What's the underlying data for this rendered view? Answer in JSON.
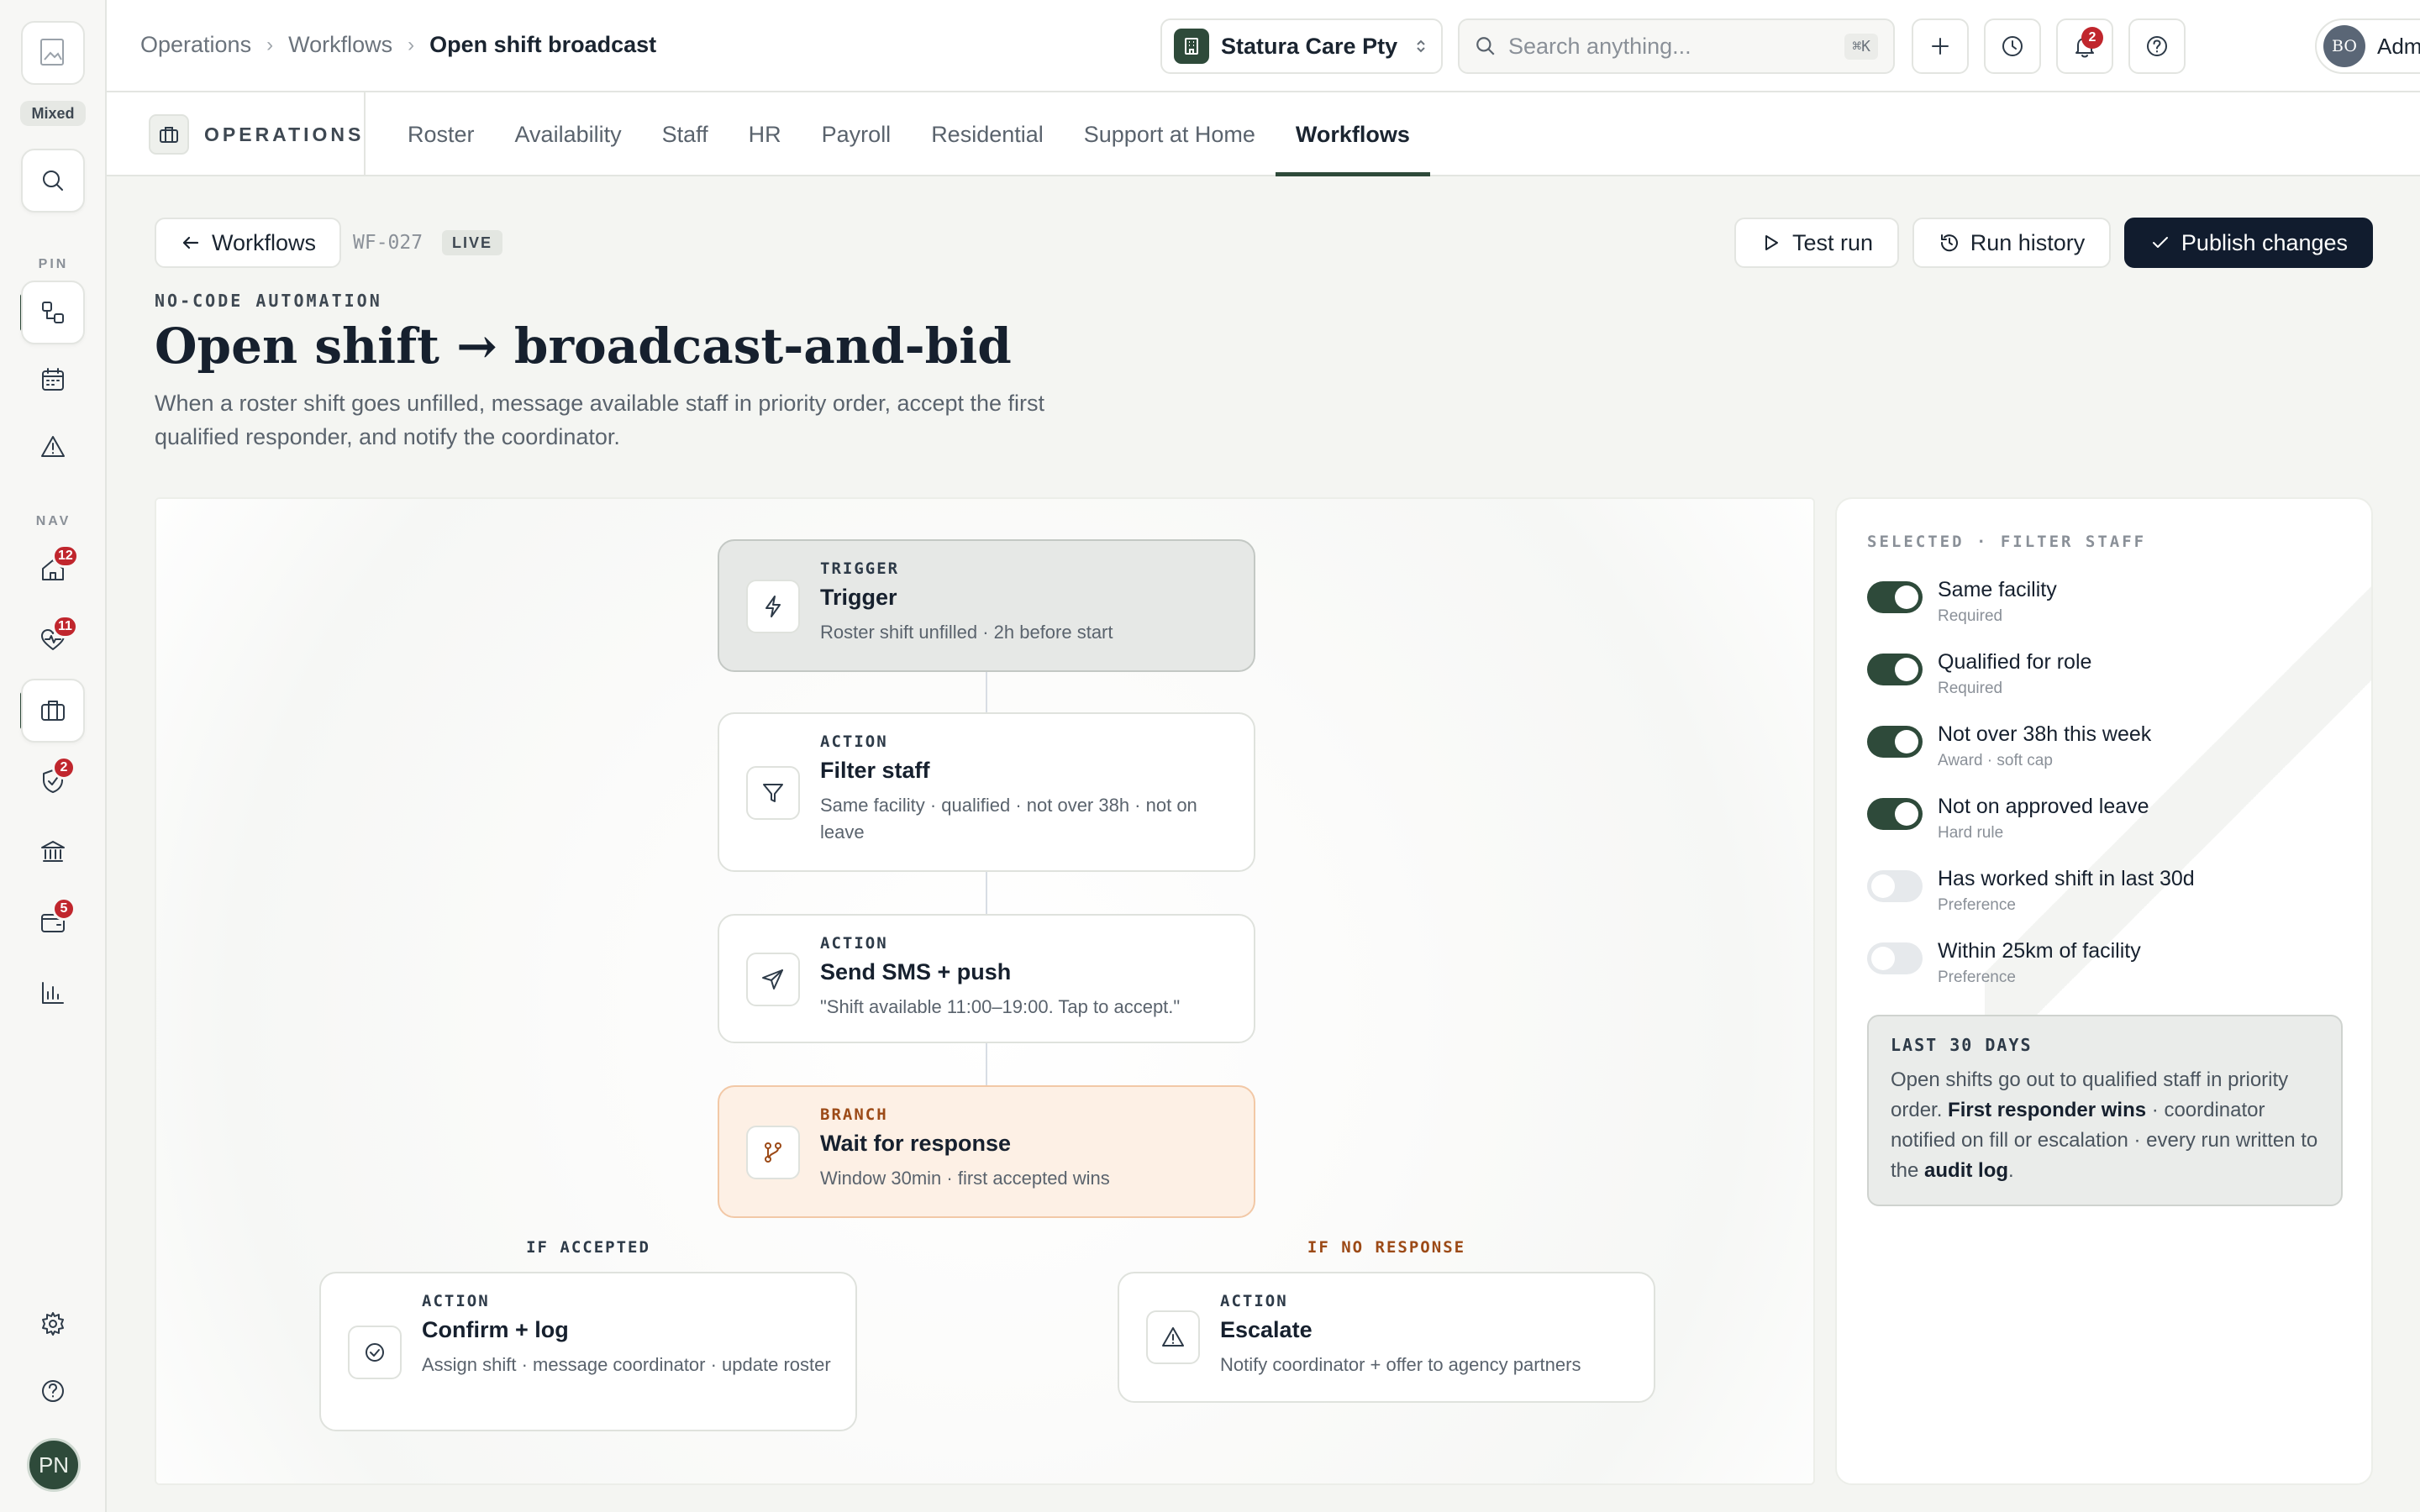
{
  "sidebar": {
    "badge_mode": "Mixed",
    "pin_label": "PIN",
    "nav_label": "NAV",
    "badges": {
      "home": "12",
      "health": "11",
      "shield": "2",
      "wallet": "5"
    },
    "avatar_initials": "PN"
  },
  "header": {
    "breadcrumbs": [
      "Operations",
      "Workflows",
      "Open shift broadcast"
    ],
    "org": "Statura Care Pty",
    "search_placeholder": "Search anything...",
    "search_shortcut": "⌘K",
    "notifications_count": "2",
    "user_initials": "BO",
    "user_name": "Admin"
  },
  "subnav": {
    "section": "OPERATIONS",
    "tabs": [
      "Roster",
      "Availability",
      "Staff",
      "HR",
      "Payroll",
      "Residential",
      "Support at Home",
      "Workflows"
    ],
    "active_tab": "Workflows"
  },
  "page": {
    "back_label": "Workflows",
    "workflow_id": "WF-027",
    "status": "LIVE",
    "eyebrow": "NO-CODE AUTOMATION",
    "title": "Open shift → broadcast-and-bid",
    "description": "When a roster shift goes unfilled, message available staff in priority order, accept the first qualified responder, and notify the coordinator.",
    "actions": {
      "test_run": "Test run",
      "run_history": "Run history",
      "publish": "Publish changes"
    }
  },
  "flow": {
    "nodes": [
      {
        "kind": "TRIGGER",
        "title": "Trigger",
        "desc": "Roster shift unfilled · 2h before start",
        "icon": "lightning-icon"
      },
      {
        "kind": "ACTION",
        "title": "Filter staff",
        "desc": "Same facility · qualified · not over 38h · not on leave",
        "icon": "filter-icon"
      },
      {
        "kind": "ACTION",
        "title": "Send SMS + push",
        "desc": "\"Shift available 11:00–19:00. Tap to accept.\"",
        "icon": "send-icon"
      },
      {
        "kind": "BRANCH",
        "title": "Wait for response",
        "desc": "Window 30min · first accepted wins",
        "icon": "branch-icon"
      }
    ],
    "branches": [
      {
        "label": "IF ACCEPTED",
        "kind": "ACTION",
        "title": "Confirm + log",
        "desc": "Assign shift · message coordinator · update roster",
        "icon": "check-circle-icon"
      },
      {
        "label": "IF NO RESPONSE",
        "kind": "ACTION",
        "title": "Escalate",
        "desc": "Notify coordinator + offer to agency partners",
        "icon": "warning-icon"
      }
    ]
  },
  "panel": {
    "heading": "SELECTED · FILTER STAFF",
    "rules": [
      {
        "label": "Same facility",
        "sub": "Required",
        "on": true
      },
      {
        "label": "Qualified for role",
        "sub": "Required",
        "on": true
      },
      {
        "label": "Not over 38h this week",
        "sub": "Award · soft cap",
        "on": true
      },
      {
        "label": "Not on approved leave",
        "sub": "Hard rule",
        "on": true
      },
      {
        "label": "Has worked shift in last 30d",
        "sub": "Preference",
        "on": false
      },
      {
        "label": "Within 25km of facility",
        "sub": "Preference",
        "on": false
      }
    ],
    "note": {
      "heading": "LAST 30 DAYS",
      "text_1": "Open shifts go out to qualified staff in priority order. ",
      "bold_1": "First responder wins",
      "text_2": " · coordinator notified on fill or escalation · every run written to the ",
      "bold_2": "audit log",
      "text_3": "."
    }
  },
  "colors": {
    "accent": "#2e4a3a",
    "primary_button": "#111c2e",
    "branch_tint": "#fdf0e5",
    "branch_text": "#9c4a17",
    "badge": "#c0262d"
  }
}
